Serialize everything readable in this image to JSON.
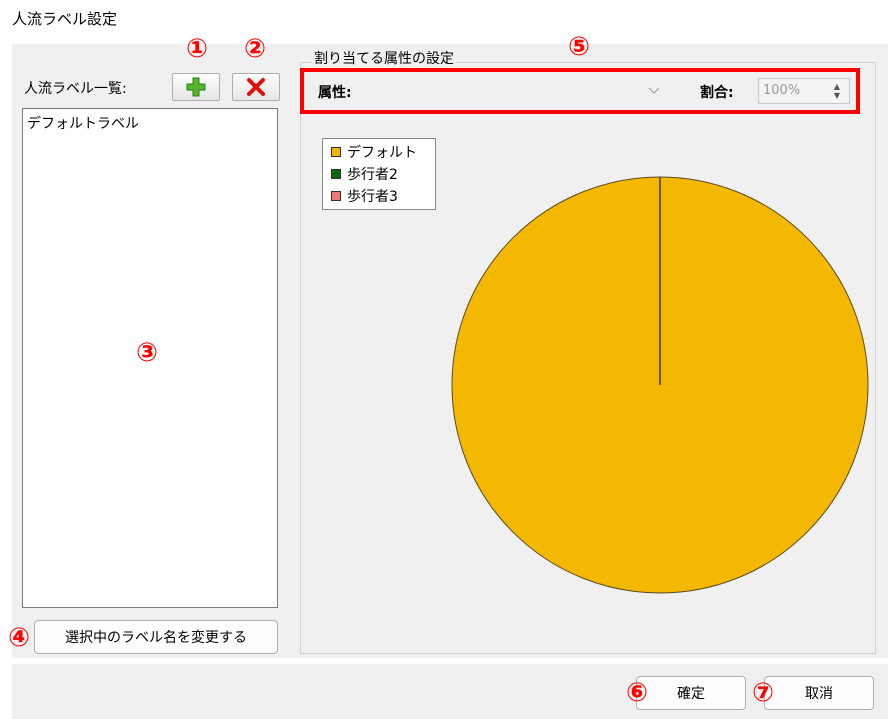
{
  "window": {
    "title": "人流ラベル設定"
  },
  "left_panel": {
    "list_label": "人流ラベル一覧:",
    "items": [
      "デフォルトラベル"
    ],
    "rename_button": "選択中のラベル名を変更する"
  },
  "right_panel": {
    "group_title": "割り当てる属性の設定",
    "attribute_label": "属性:",
    "attribute_value": "",
    "ratio_label": "割合:",
    "ratio_value": "100%"
  },
  "legend": [
    {
      "label": "デフォルト",
      "color": "#f5b800"
    },
    {
      "label": "歩行者2",
      "color": "#0b6a0b"
    },
    {
      "label": "歩行者3",
      "color": "#f07878"
    }
  ],
  "chart_data": {
    "type": "pie",
    "categories": [
      "デフォルト",
      "歩行者2",
      "歩行者3"
    ],
    "values": [
      100,
      0,
      0
    ],
    "colors": [
      "#f5b800",
      "#0b6a0b",
      "#f07878"
    ],
    "legend": "top-left"
  },
  "footer": {
    "ok_label": "確定",
    "cancel_label": "取消"
  },
  "annotations": [
    "①",
    "②",
    "③",
    "④",
    "⑤",
    "⑥",
    "⑦"
  ],
  "icons": {
    "add": "plus-icon",
    "delete": "x-icon"
  }
}
